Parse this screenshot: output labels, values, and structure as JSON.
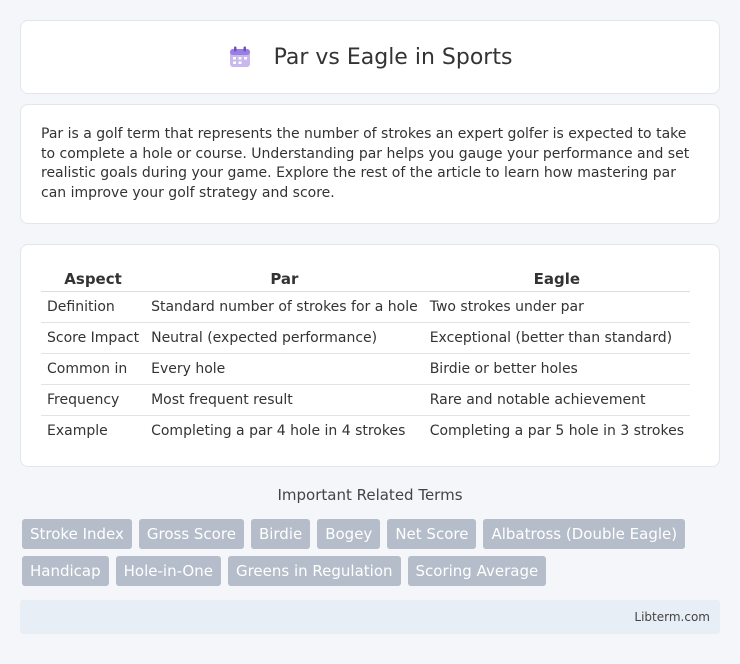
{
  "header": {
    "title": "Par vs Eagle in Sports",
    "icon": "calendar-icon"
  },
  "intro": {
    "text": "Par is a golf term that represents the number of strokes an expert golfer is expected to take to complete a hole or course. Understanding par helps you gauge your performance and set realistic goals during your game. Explore the rest of the article to learn how mastering par can improve your golf strategy and score."
  },
  "table": {
    "headers": [
      "Aspect",
      "Par",
      "Eagle"
    ],
    "rows": [
      [
        "Definition",
        "Standard number of strokes for a hole",
        "Two strokes under par"
      ],
      [
        "Score Impact",
        "Neutral (expected performance)",
        "Exceptional (better than standard)"
      ],
      [
        "Common in",
        "Every hole",
        "Birdie or better holes"
      ],
      [
        "Frequency",
        "Most frequent result",
        "Rare and notable achievement"
      ],
      [
        "Example",
        "Completing a par 4 hole in 4 strokes",
        "Completing a par 5 hole in 3 strokes"
      ]
    ]
  },
  "related": {
    "title": "Important Related Terms",
    "tags": [
      "Stroke Index",
      "Gross Score",
      "Birdie",
      "Bogey",
      "Net Score",
      "Albatross (Double Eagle)",
      "Handicap",
      "Hole-in-One",
      "Greens in Regulation",
      "Scoring Average"
    ]
  },
  "footer": {
    "source": "Libterm.com"
  },
  "colors": {
    "tag_bg": "#b4bdc9",
    "footer_bg": "#e8eef6",
    "page_bg": "#f4f6f9"
  }
}
